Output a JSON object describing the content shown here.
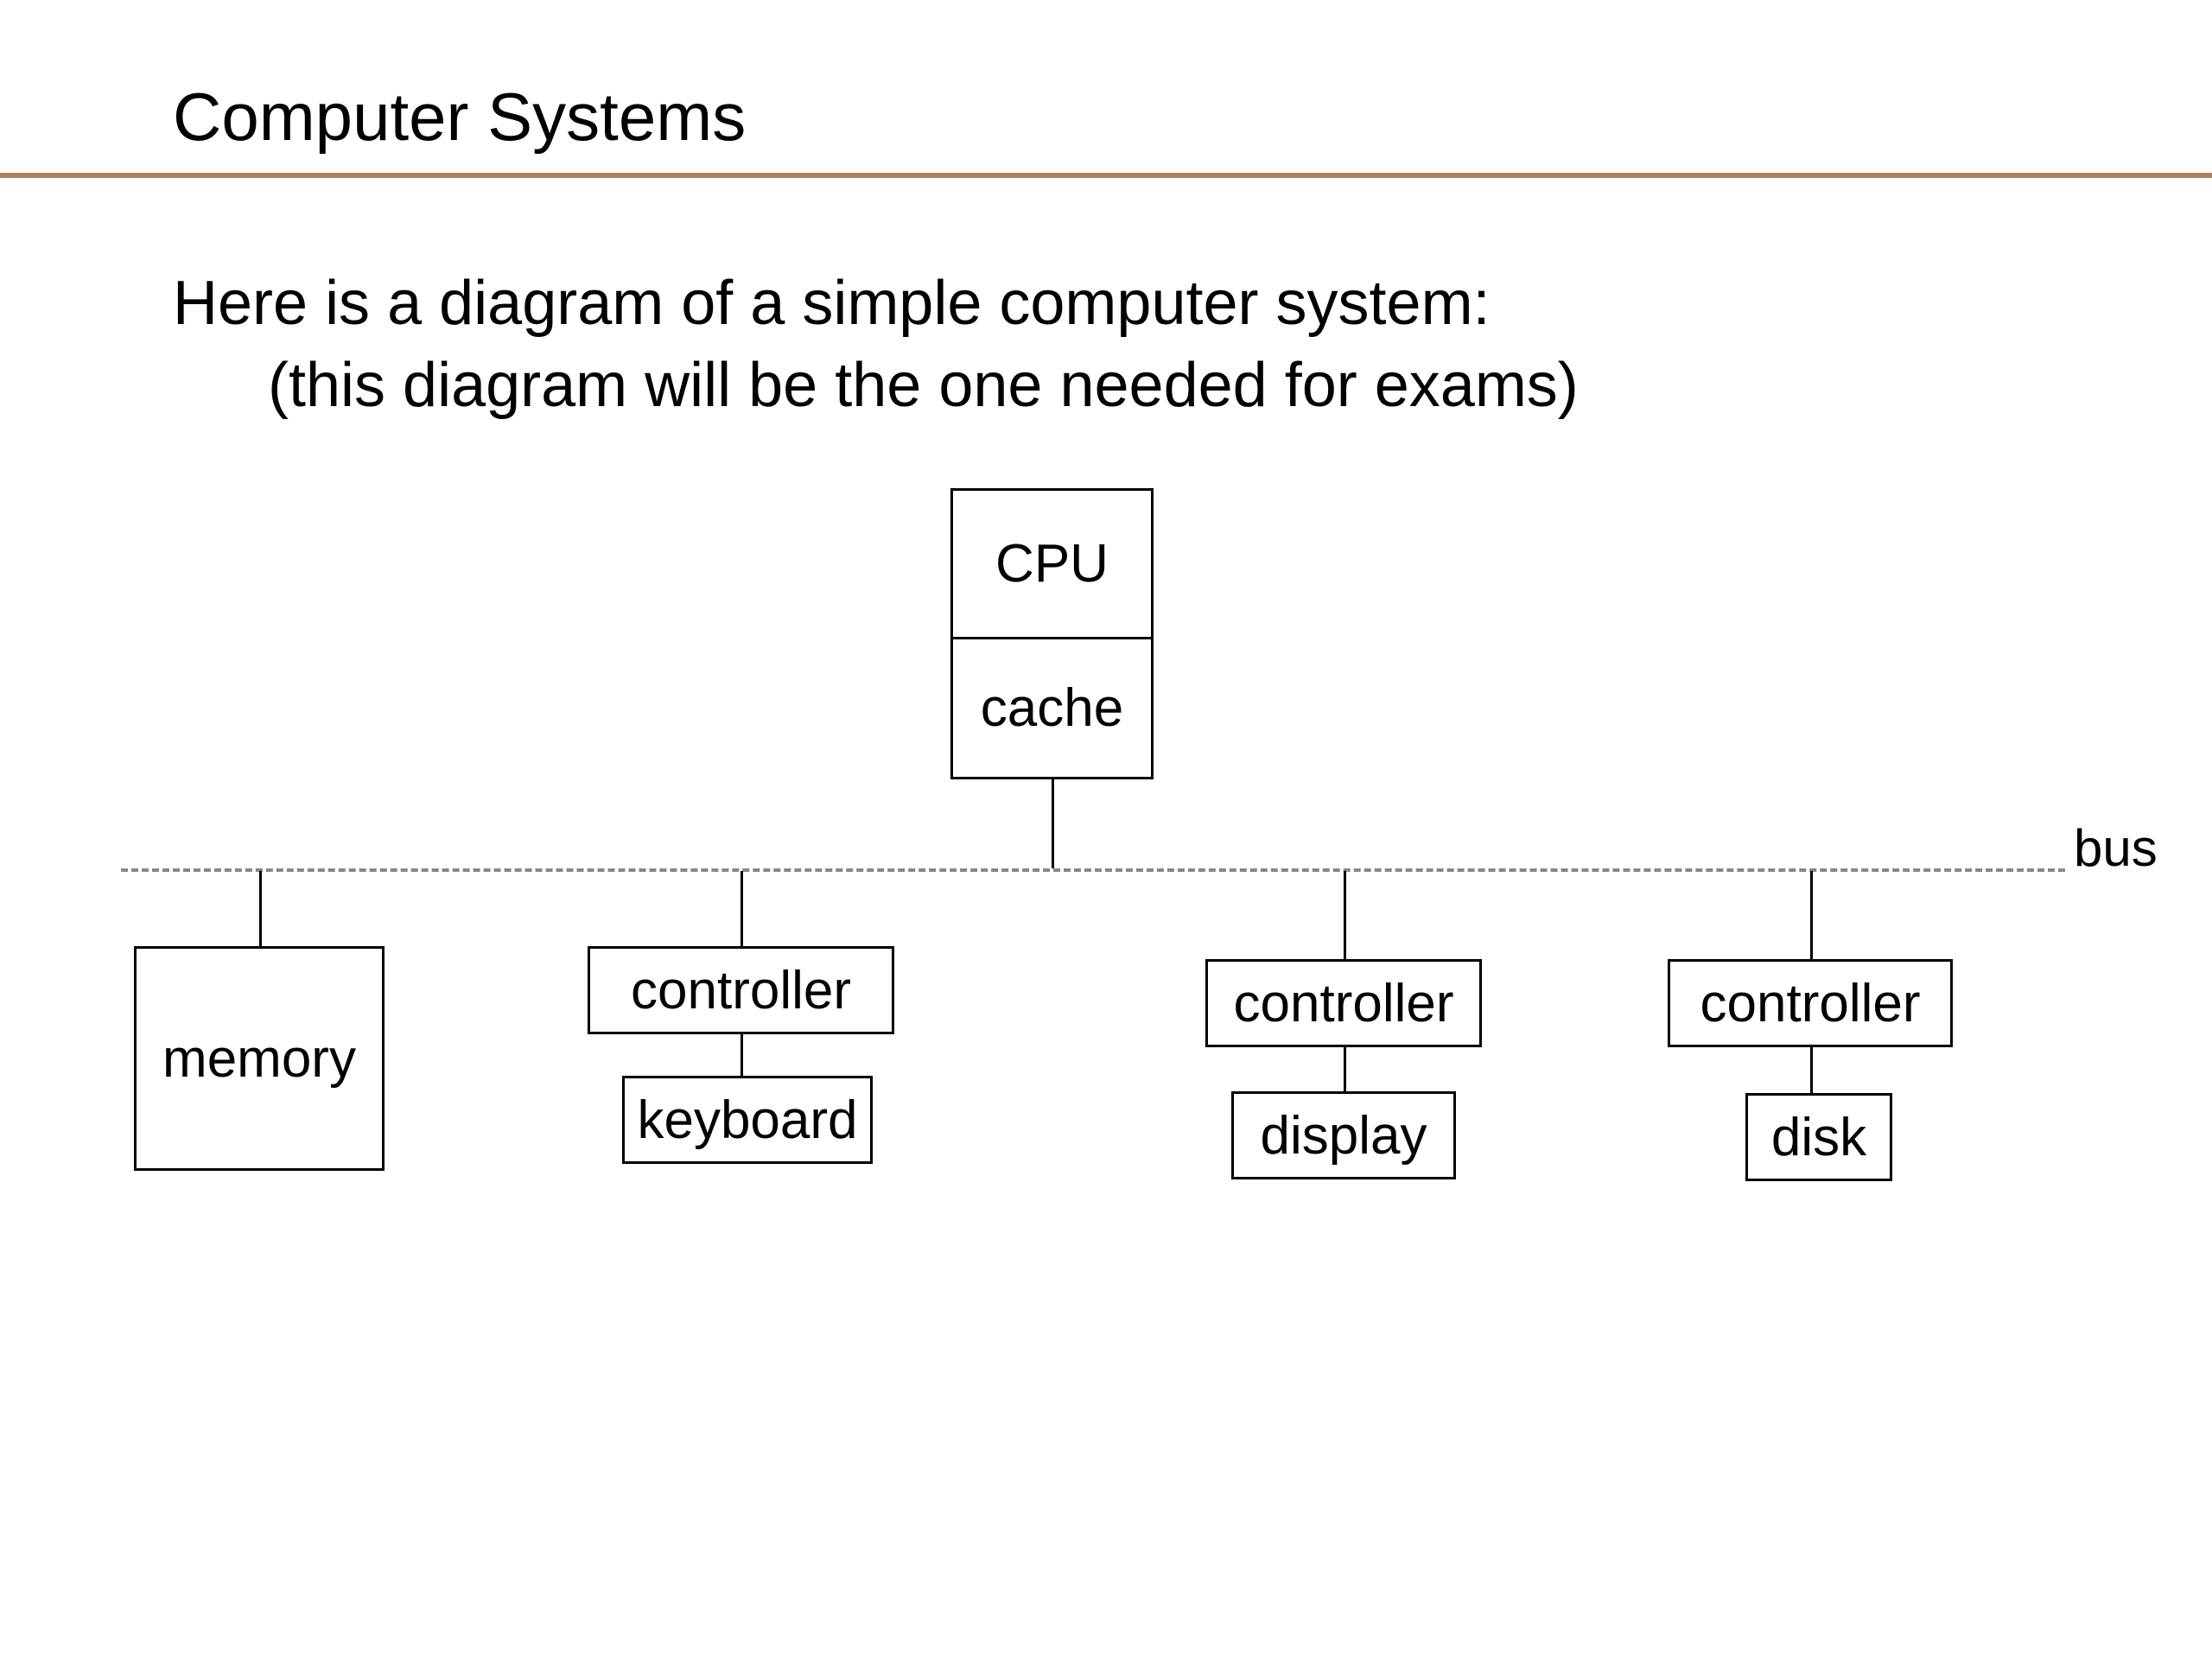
{
  "title": "Computer Systems",
  "body": {
    "line1": "Here is a diagram of a simple computer system:",
    "line2": "(this diagram will be the one needed for exams)"
  },
  "diagram": {
    "cpu": "CPU",
    "cache": "cache",
    "bus_label": "bus",
    "memory": "memory",
    "controller": "controller",
    "keyboard": "keyboard",
    "display": "display",
    "disk": "disk"
  }
}
